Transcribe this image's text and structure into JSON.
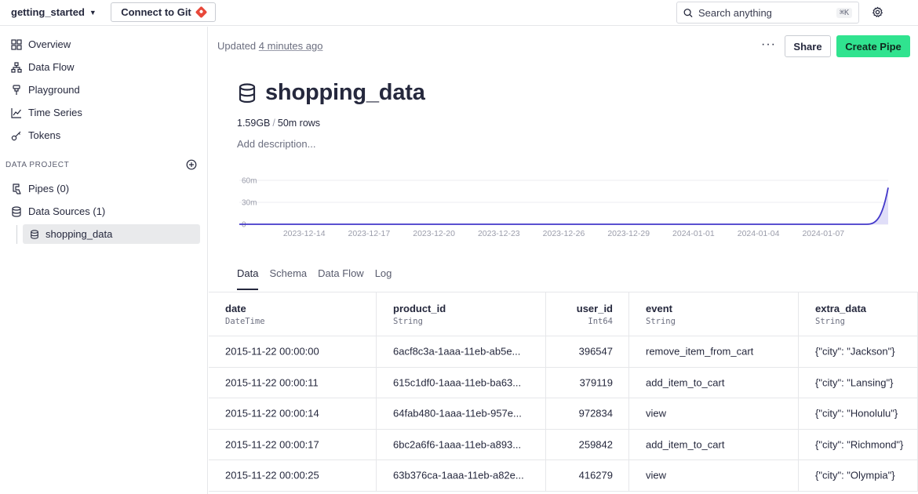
{
  "topbar": {
    "workspace": "getting_started",
    "git_button": "Connect to Git",
    "search_placeholder": "Search anything",
    "search_shortcut": "⌘K"
  },
  "sidebar": {
    "items": [
      {
        "label": "Overview",
        "icon": "grid-icon"
      },
      {
        "label": "Data Flow",
        "icon": "data-flow-icon"
      },
      {
        "label": "Playground",
        "icon": "playground-icon"
      },
      {
        "label": "Time Series",
        "icon": "time-series-icon"
      },
      {
        "label": "Tokens",
        "icon": "key-icon"
      }
    ],
    "section_title": "DATA PROJECT",
    "pipes": "Pipes (0)",
    "data_sources": "Data Sources (1)",
    "active_source": "shopping_data"
  },
  "header": {
    "updated_prefix": "Updated",
    "updated_time": "4 minutes ago",
    "more": "···",
    "share": "Share",
    "create_pipe": "Create Pipe"
  },
  "datasource": {
    "name": "shopping_data",
    "size": "1.59GB",
    "rows": "50m rows",
    "description_placeholder": "Add description..."
  },
  "chart_data": {
    "type": "area",
    "x": [
      "2023-12-11",
      "2023-12-14",
      "2023-12-17",
      "2023-12-20",
      "2023-12-23",
      "2023-12-26",
      "2023-12-29",
      "2024-01-01",
      "2024-01-04",
      "2024-01-07",
      "2024-01-09",
      "2024-01-10"
    ],
    "x_tick_labels": [
      "2023-12-14",
      "2023-12-17",
      "2023-12-20",
      "2023-12-23",
      "2023-12-26",
      "2023-12-29",
      "2024-01-01",
      "2024-01-04",
      "2024-01-07"
    ],
    "y_tick_labels": [
      "60m",
      "30m",
      "0"
    ],
    "ylim": [
      0,
      60000000
    ],
    "series": [
      {
        "values": [
          0,
          0,
          0,
          0,
          0,
          0,
          0,
          0,
          0,
          0,
          0,
          50000000
        ]
      }
    ],
    "line_color": "#4338ca",
    "fill_color": "#e0def8",
    "grid": true
  },
  "tabs": [
    "Data",
    "Schema",
    "Data Flow",
    "Log"
  ],
  "table": {
    "columns": [
      {
        "name": "date",
        "type": "DateTime",
        "align": "left"
      },
      {
        "name": "product_id",
        "type": "String",
        "align": "left"
      },
      {
        "name": "user_id",
        "type": "Int64",
        "align": "right"
      },
      {
        "name": "event",
        "type": "String",
        "align": "left"
      },
      {
        "name": "extra_data",
        "type": "String",
        "align": "left"
      }
    ],
    "rows": [
      [
        "2015-11-22 00:00:00",
        "6acf8c3a-1aaa-11eb-ab5e...",
        "396547",
        "remove_item_from_cart",
        "{\"city\": \"Jackson\"}"
      ],
      [
        "2015-11-22 00:00:11",
        "615c1df0-1aaa-11eb-ba63...",
        "379119",
        "add_item_to_cart",
        "{\"city\": \"Lansing\"}"
      ],
      [
        "2015-11-22 00:00:14",
        "64fab480-1aaa-11eb-957e...",
        "972834",
        "view",
        "{\"city\": \"Honolulu\"}"
      ],
      [
        "2015-11-22 00:00:17",
        "6bc2a6f6-1aaa-11eb-a893...",
        "259842",
        "add_item_to_cart",
        "{\"city\": \"Richmond\"}"
      ],
      [
        "2015-11-22 00:00:25",
        "63b376ca-1aaa-11eb-a82e...",
        "416279",
        "view",
        "{\"city\": \"Olympia\"}"
      ]
    ]
  }
}
